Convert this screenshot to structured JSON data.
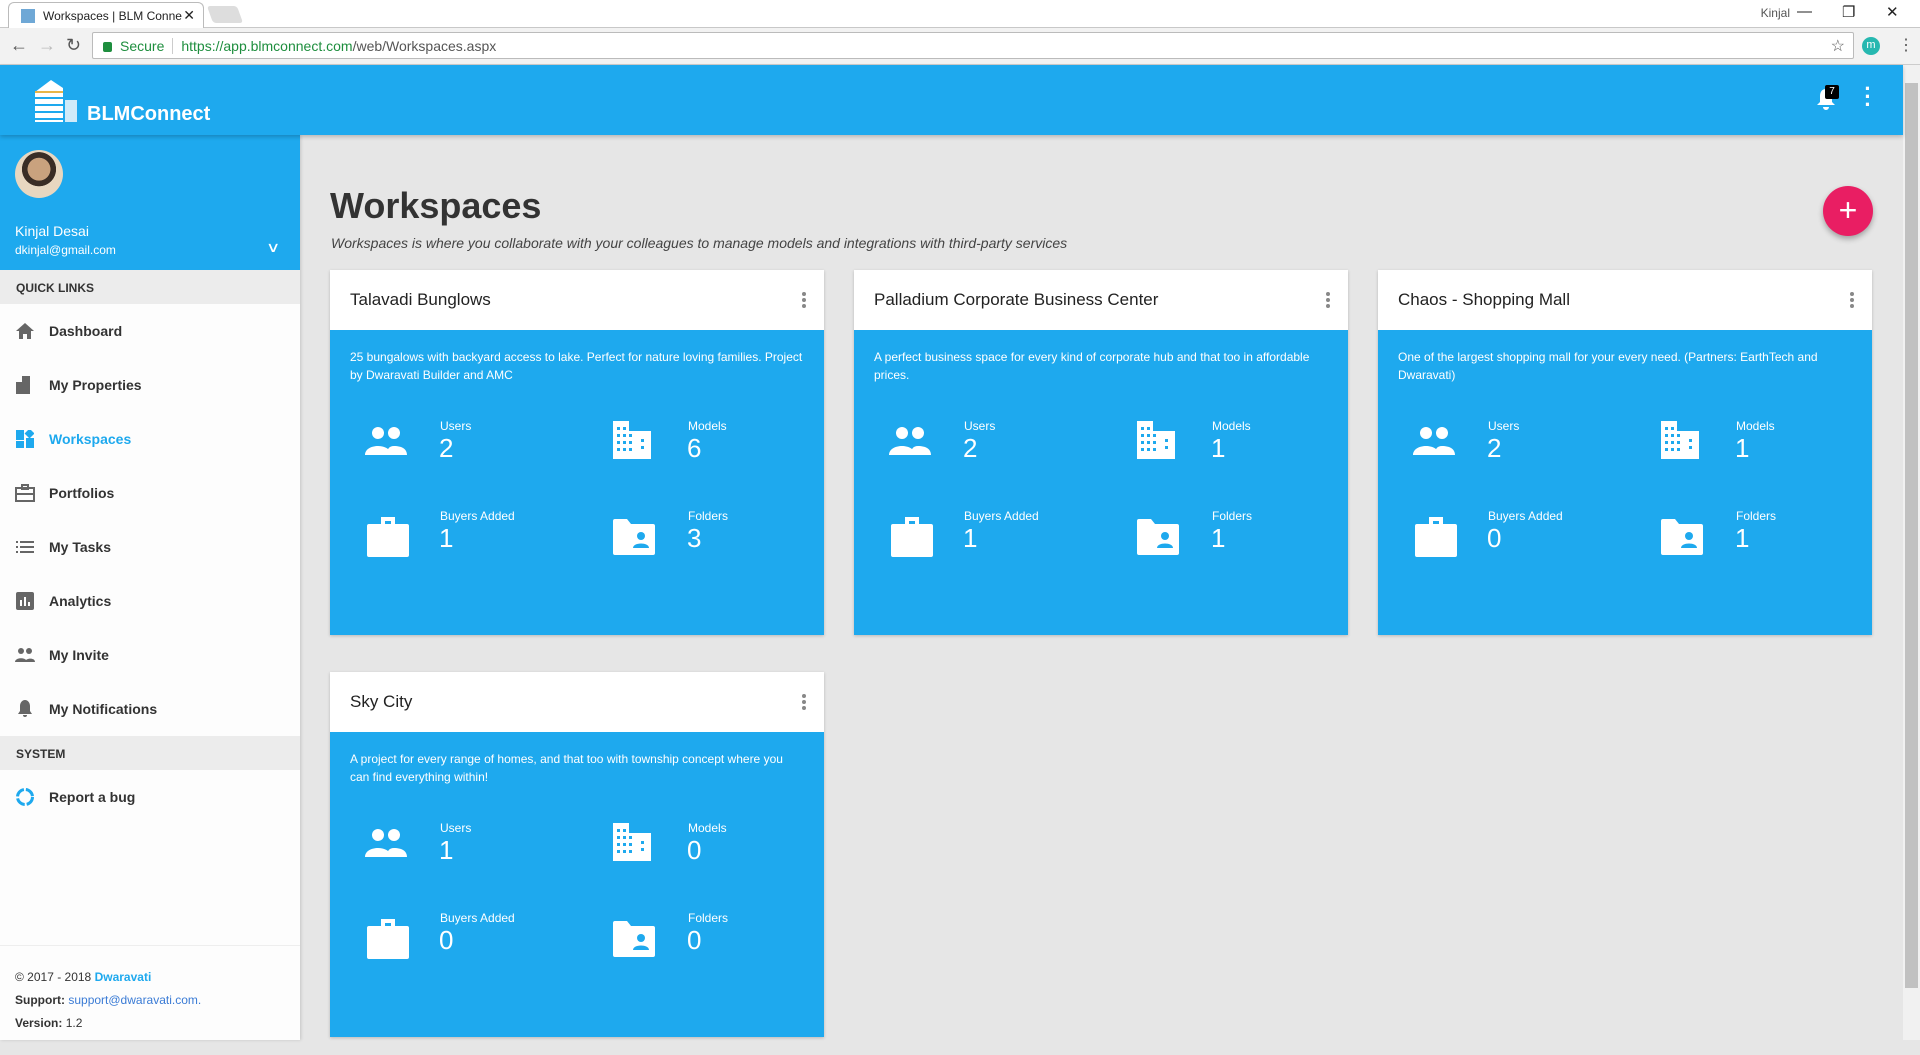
{
  "browser": {
    "tab_title": "Workspaces | BLM Conne",
    "window_user": "Kinjal",
    "secure_label": "Secure",
    "url_host": "https://app.blmconnect.com",
    "url_path": "/web/Workspaces.aspx",
    "extension_letter": "m"
  },
  "header": {
    "brand": "BLMConnect",
    "notification_count": "7"
  },
  "user": {
    "name": "Kinjal Desai",
    "email": "dkinjal@gmail.com"
  },
  "sidebar": {
    "quick_links_label": "QUICK LINKS",
    "items": [
      {
        "label": "Dashboard",
        "icon": "home-icon"
      },
      {
        "label": "My Properties",
        "icon": "building-icon"
      },
      {
        "label": "Workspaces",
        "icon": "workspaces-icon",
        "active": true
      },
      {
        "label": "Portfolios",
        "icon": "briefcase-icon"
      },
      {
        "label": "My Tasks",
        "icon": "list-icon"
      },
      {
        "label": "Analytics",
        "icon": "chart-icon"
      },
      {
        "label": "My Invite",
        "icon": "people-icon"
      },
      {
        "label": "My Notifications",
        "icon": "bell-icon"
      }
    ],
    "system_label": "SYSTEM",
    "report_bug": "Report a bug"
  },
  "footer": {
    "copyright": "© 2017 - 2018 ",
    "company": "Dwaravati",
    "support_label": "Support:",
    "support_email": "support@dwaravati.com.",
    "version_label": "Version:",
    "version": "1.2"
  },
  "page": {
    "title": "Workspaces",
    "subtitle": "Workspaces is where you collaborate with your colleagues to manage models and integrations with third-party services",
    "add_button": "+"
  },
  "stat_labels": {
    "users": "Users",
    "models": "Models",
    "buyers": "Buyers Added",
    "folders": "Folders"
  },
  "workspaces": [
    {
      "name": "Talavadi Bunglows",
      "description": "25 bungalows with backyard access to lake. Perfect for nature loving families. Project by Dwaravati Builder and AMC",
      "users": "2",
      "models": "6",
      "buyers": "1",
      "folders": "3"
    },
    {
      "name": "Palladium Corporate Business Center",
      "description": "A perfect business space for every kind of corporate hub and that too in affordable prices.",
      "users": "2",
      "models": "1",
      "buyers": "1",
      "folders": "1"
    },
    {
      "name": "Chaos - Shopping Mall",
      "description": "One of the largest shopping mall for your every need. (Partners: EarthTech and Dwaravati)",
      "users": "2",
      "models": "1",
      "buyers": "0",
      "folders": "1"
    },
    {
      "name": "Sky City",
      "description": "A project for every range of homes, and that too with township concept where you can find everything within!",
      "users": "1",
      "models": "0",
      "buyers": "0",
      "folders": "0"
    }
  ],
  "colors": {
    "primary": "#1ea9ee",
    "fab": "#e91e63",
    "background": "#e6e6e6"
  }
}
